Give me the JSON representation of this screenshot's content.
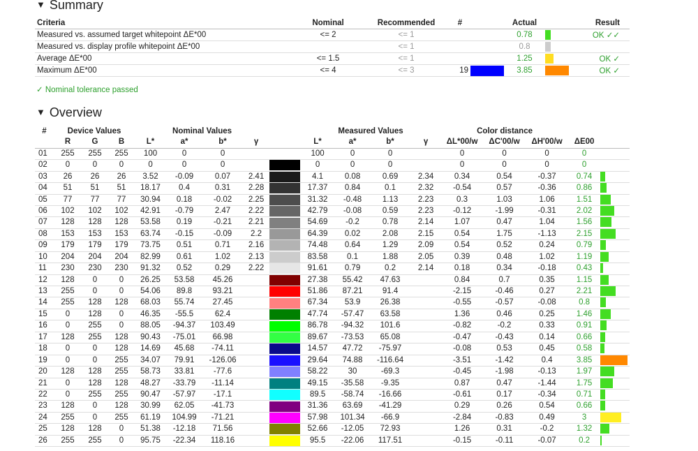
{
  "summary": {
    "title": "Summary",
    "headers": [
      "Criteria",
      "Nominal",
      "Recommended",
      "#",
      "Actual",
      "Result"
    ],
    "rows": [
      {
        "criteria": "Measured vs. assumed target whitepoint ΔE*00",
        "nominal": "<= 2",
        "recommended": "<= 1",
        "num": "",
        "actual": "0.78",
        "bar_color": "#44dd22",
        "bar_fraction": 0.23,
        "result": "OK ✓✓",
        "actual_grey": false
      },
      {
        "criteria": "Measured vs. display profile whitepoint ΔE*00",
        "nominal": "",
        "recommended": "<= 1",
        "num": "",
        "actual": "0.8",
        "bar_color": "#cccccc",
        "bar_fraction": 0.23,
        "result": "",
        "actual_grey": true
      },
      {
        "criteria": "Average ΔE*00",
        "nominal": "<= 1.5",
        "recommended": "<= 1",
        "num": "",
        "actual": "1.25",
        "bar_color": "#ffdd22",
        "bar_fraction": 0.35,
        "result": "OK ✓",
        "actual_grey": false
      },
      {
        "criteria": "Maximum ΔE*00",
        "nominal": "<= 4",
        "recommended": "<= 3",
        "num": "19",
        "actual": "3.85",
        "bar_color": "#ff8800",
        "bar_fraction": 1.0,
        "result": "OK ✓",
        "actual_grey": false,
        "swatch": "#0000ff"
      }
    ],
    "passed_text": "✓ Nominal tolerance passed"
  },
  "overview": {
    "title": "Overview",
    "group_headers": {
      "num": "#",
      "device": "Device Values",
      "nominal": "Nominal Values",
      "measured": "Measured Values",
      "distance": "Color distance"
    },
    "sub_headers": {
      "r": "R",
      "g": "G",
      "b": "B",
      "l": "L*",
      "a": "a*",
      "bb": "b*",
      "gamma": "γ",
      "ml": "L*",
      "ma": "a*",
      "mb": "b*",
      "mgamma": "γ",
      "dl": "ΔL*00/w",
      "dc": "ΔC'00/w",
      "dh": "ΔH'00/w",
      "de": "ΔE00"
    },
    "rows": [
      {
        "n": "01",
        "r": "255",
        "g": "255",
        "b": "255",
        "L": "100",
        "a": "0",
        "bb": "0",
        "gam": "",
        "color": "#ffffff",
        "mL": "100",
        "ma": "0",
        "mb": "0",
        "mg": "",
        "dL": "0",
        "dC": "0",
        "dH": "0",
        "dE": "0",
        "bar": 0,
        "barColor": "#44dd22"
      },
      {
        "n": "02",
        "r": "0",
        "g": "0",
        "b": "0",
        "L": "0",
        "a": "0",
        "bb": "0",
        "gam": "",
        "color": "#000000",
        "mL": "0",
        "ma": "0",
        "mb": "0",
        "mg": "",
        "dL": "0",
        "dC": "0",
        "dH": "0",
        "dE": "0",
        "bar": 0,
        "barColor": "#44dd22"
      },
      {
        "n": "03",
        "r": "26",
        "g": "26",
        "b": "26",
        "L": "3.52",
        "a": "-0.09",
        "bb": "0.07",
        "gam": "2.41",
        "color": "#1a1a1a",
        "mL": "4.1",
        "ma": "0.08",
        "mb": "0.69",
        "mg": "2.34",
        "dL": "0.34",
        "dC": "0.54",
        "dH": "-0.37",
        "dE": "0.74",
        "bar": 0.74,
        "barColor": "#44dd22"
      },
      {
        "n": "04",
        "r": "51",
        "g": "51",
        "b": "51",
        "L": "18.17",
        "a": "0.4",
        "bb": "0.31",
        "gam": "2.28",
        "color": "#333333",
        "mL": "17.37",
        "ma": "0.84",
        "mb": "0.1",
        "mg": "2.32",
        "dL": "-0.54",
        "dC": "0.57",
        "dH": "-0.36",
        "dE": "0.86",
        "bar": 0.86,
        "barColor": "#44dd22"
      },
      {
        "n": "05",
        "r": "77",
        "g": "77",
        "b": "77",
        "L": "30.94",
        "a": "0.18",
        "bb": "-0.02",
        "gam": "2.25",
        "color": "#4d4d4d",
        "mL": "31.32",
        "ma": "-0.48",
        "mb": "1.13",
        "mg": "2.23",
        "dL": "0.3",
        "dC": "1.03",
        "dH": "1.06",
        "dE": "1.51",
        "bar": 1.51,
        "barColor": "#44dd22"
      },
      {
        "n": "06",
        "r": "102",
        "g": "102",
        "b": "102",
        "L": "42.91",
        "a": "-0.79",
        "bb": "2.47",
        "gam": "2.22",
        "color": "#666666",
        "mL": "42.79",
        "ma": "-0.08",
        "mb": "0.59",
        "mg": "2.23",
        "dL": "-0.12",
        "dC": "-1.99",
        "dH": "-0.31",
        "dE": "2.02",
        "bar": 2.02,
        "barColor": "#44dd22"
      },
      {
        "n": "07",
        "r": "128",
        "g": "128",
        "b": "128",
        "L": "53.58",
        "a": "0.19",
        "bb": "-0.21",
        "gam": "2.21",
        "color": "#808080",
        "mL": "54.69",
        "ma": "-0.2",
        "mb": "0.78",
        "mg": "2.14",
        "dL": "1.07",
        "dC": "0.47",
        "dH": "1.04",
        "dE": "1.56",
        "bar": 1.56,
        "barColor": "#44dd22"
      },
      {
        "n": "08",
        "r": "153",
        "g": "153",
        "b": "153",
        "L": "63.74",
        "a": "-0.15",
        "bb": "-0.09",
        "gam": "2.2",
        "color": "#999999",
        "mL": "64.39",
        "ma": "0.02",
        "mb": "2.08",
        "mg": "2.15",
        "dL": "0.54",
        "dC": "1.75",
        "dH": "-1.13",
        "dE": "2.15",
        "bar": 2.15,
        "barColor": "#44dd22"
      },
      {
        "n": "09",
        "r": "179",
        "g": "179",
        "b": "179",
        "L": "73.75",
        "a": "0.51",
        "bb": "0.71",
        "gam": "2.16",
        "color": "#b3b3b3",
        "mL": "74.48",
        "ma": "0.64",
        "mb": "1.29",
        "mg": "2.09",
        "dL": "0.54",
        "dC": "0.52",
        "dH": "0.24",
        "dE": "0.79",
        "bar": 0.79,
        "barColor": "#44dd22"
      },
      {
        "n": "10",
        "r": "204",
        "g": "204",
        "b": "204",
        "L": "82.99",
        "a": "0.61",
        "bb": "1.02",
        "gam": "2.13",
        "color": "#cccccc",
        "mL": "83.58",
        "ma": "0.1",
        "mb": "1.88",
        "mg": "2.05",
        "dL": "0.39",
        "dC": "0.48",
        "dH": "1.02",
        "dE": "1.19",
        "bar": 1.19,
        "barColor": "#44dd22"
      },
      {
        "n": "11",
        "r": "230",
        "g": "230",
        "b": "230",
        "L": "91.32",
        "a": "0.52",
        "bb": "0.29",
        "gam": "2.22",
        "color": "#e6e6e6",
        "mL": "91.61",
        "ma": "0.79",
        "mb": "0.2",
        "mg": "2.14",
        "dL": "0.18",
        "dC": "0.34",
        "dH": "-0.18",
        "dE": "0.43",
        "bar": 0.43,
        "barColor": "#44dd22"
      },
      {
        "n": "12",
        "r": "128",
        "g": "0",
        "b": "0",
        "L": "26.25",
        "a": "53.58",
        "bb": "45.26",
        "gam": "",
        "color": "#800000",
        "mL": "27.38",
        "ma": "55.42",
        "mb": "47.63",
        "mg": "",
        "dL": "0.84",
        "dC": "0.7",
        "dH": "0.35",
        "dE": "1.15",
        "bar": 1.15,
        "barColor": "#44dd22"
      },
      {
        "n": "13",
        "r": "255",
        "g": "0",
        "b": "0",
        "L": "54.06",
        "a": "89.8",
        "bb": "93.21",
        "gam": "",
        "color": "#ff0000",
        "mL": "51.86",
        "ma": "87.21",
        "mb": "91.4",
        "mg": "",
        "dL": "-2.15",
        "dC": "-0.46",
        "dH": "0.27",
        "dE": "2.21",
        "bar": 2.21,
        "barColor": "#44dd22"
      },
      {
        "n": "14",
        "r": "255",
        "g": "128",
        "b": "128",
        "L": "68.03",
        "a": "55.74",
        "bb": "27.45",
        "gam": "",
        "color": "#ff8080",
        "mL": "67.34",
        "ma": "53.9",
        "mb": "26.38",
        "mg": "",
        "dL": "-0.55",
        "dC": "-0.57",
        "dH": "-0.08",
        "dE": "0.8",
        "bar": 0.8,
        "barColor": "#44dd22"
      },
      {
        "n": "15",
        "r": "0",
        "g": "128",
        "b": "0",
        "L": "46.35",
        "a": "-55.5",
        "bb": "62.4",
        "gam": "",
        "color": "#008000",
        "mL": "47.74",
        "ma": "-57.47",
        "mb": "63.58",
        "mg": "",
        "dL": "1.36",
        "dC": "0.46",
        "dH": "0.25",
        "dE": "1.46",
        "bar": 1.46,
        "barColor": "#44dd22"
      },
      {
        "n": "16",
        "r": "0",
        "g": "255",
        "b": "0",
        "L": "88.05",
        "a": "-94.37",
        "bb": "103.49",
        "gam": "",
        "color": "#00ff00",
        "mL": "86.78",
        "ma": "-94.32",
        "mb": "101.6",
        "mg": "",
        "dL": "-0.82",
        "dC": "-0.2",
        "dH": "0.33",
        "dE": "0.91",
        "bar": 0.91,
        "barColor": "#44dd22"
      },
      {
        "n": "17",
        "r": "128",
        "g": "255",
        "b": "128",
        "L": "90.43",
        "a": "-75.01",
        "bb": "66.98",
        "gam": "",
        "color": "#33ff44",
        "mL": "89.67",
        "ma": "-73.53",
        "mb": "65.08",
        "mg": "",
        "dL": "-0.47",
        "dC": "-0.43",
        "dH": "0.14",
        "dE": "0.66",
        "bar": 0.66,
        "barColor": "#44dd22"
      },
      {
        "n": "18",
        "r": "0",
        "g": "0",
        "b": "128",
        "L": "14.69",
        "a": "45.68",
        "bb": "-74.11",
        "gam": "",
        "color": "#0a0a8a",
        "mL": "14.57",
        "ma": "47.72",
        "mb": "-75.97",
        "mg": "",
        "dL": "-0.08",
        "dC": "0.53",
        "dH": "0.45",
        "dE": "0.58",
        "bar": 0.58,
        "barColor": "#44dd22"
      },
      {
        "n": "19",
        "r": "0",
        "g": "0",
        "b": "255",
        "L": "34.07",
        "a": "79.91",
        "bb": "-126.06",
        "gam": "",
        "color": "#1a10ff",
        "mL": "29.64",
        "ma": "74.88",
        "mb": "-116.64",
        "mg": "",
        "dL": "-3.51",
        "dC": "-1.42",
        "dH": "0.4",
        "dE": "3.85",
        "bar": 3.85,
        "barColor": "#ff8800"
      },
      {
        "n": "20",
        "r": "128",
        "g": "128",
        "b": "255",
        "L": "58.73",
        "a": "33.81",
        "bb": "-77.6",
        "gam": "",
        "color": "#8080ff",
        "mL": "58.22",
        "ma": "30",
        "mb": "-69.3",
        "mg": "",
        "dL": "-0.45",
        "dC": "-1.98",
        "dH": "-0.13",
        "dE": "1.97",
        "bar": 1.97,
        "barColor": "#44dd22"
      },
      {
        "n": "21",
        "r": "0",
        "g": "128",
        "b": "128",
        "L": "48.27",
        "a": "-33.79",
        "bb": "-11.14",
        "gam": "",
        "color": "#008080",
        "mL": "49.15",
        "ma": "-35.58",
        "mb": "-9.35",
        "mg": "",
        "dL": "0.87",
        "dC": "0.47",
        "dH": "-1.44",
        "dE": "1.75",
        "bar": 1.75,
        "barColor": "#44dd22"
      },
      {
        "n": "22",
        "r": "0",
        "g": "255",
        "b": "255",
        "L": "90.47",
        "a": "-57.97",
        "bb": "-17.1",
        "gam": "",
        "color": "#11ffff",
        "mL": "89.5",
        "ma": "-58.74",
        "mb": "-16.66",
        "mg": "",
        "dL": "-0.61",
        "dC": "0.17",
        "dH": "-0.34",
        "dE": "0.71",
        "bar": 0.71,
        "barColor": "#44dd22"
      },
      {
        "n": "23",
        "r": "128",
        "g": "0",
        "b": "128",
        "L": "30.99",
        "a": "62.05",
        "bb": "-41.73",
        "gam": "",
        "color": "#800080",
        "mL": "31.36",
        "ma": "63.69",
        "mb": "-41.29",
        "mg": "",
        "dL": "0.29",
        "dC": "0.26",
        "dH": "0.54",
        "dE": "0.66",
        "bar": 0.66,
        "barColor": "#44dd22"
      },
      {
        "n": "24",
        "r": "255",
        "g": "0",
        "b": "255",
        "L": "61.19",
        "a": "104.99",
        "bb": "-71.21",
        "gam": "",
        "color": "#ff00ff",
        "mL": "57.98",
        "ma": "101.34",
        "mb": "-66.9",
        "mg": "",
        "dL": "-2.84",
        "dC": "-0.83",
        "dH": "0.49",
        "dE": "3",
        "bar": 3.0,
        "barColor": "#ffee22"
      },
      {
        "n": "25",
        "r": "128",
        "g": "128",
        "b": "0",
        "L": "51.38",
        "a": "-12.18",
        "bb": "71.56",
        "gam": "",
        "color": "#808000",
        "mL": "52.66",
        "ma": "-12.05",
        "mb": "72.93",
        "mg": "",
        "dL": "1.26",
        "dC": "0.31",
        "dH": "-0.2",
        "dE": "1.32",
        "bar": 1.32,
        "barColor": "#44dd22"
      },
      {
        "n": "26",
        "r": "255",
        "g": "255",
        "b": "0",
        "L": "95.75",
        "a": "-22.34",
        "bb": "118.16",
        "gam": "",
        "color": "#ffff00",
        "mL": "95.5",
        "ma": "-22.06",
        "mb": "117.51",
        "mg": "",
        "dL": "-0.15",
        "dC": "-0.11",
        "dH": "-0.07",
        "dE": "0.2",
        "bar": 0.2,
        "barColor": "#44dd22"
      }
    ]
  }
}
